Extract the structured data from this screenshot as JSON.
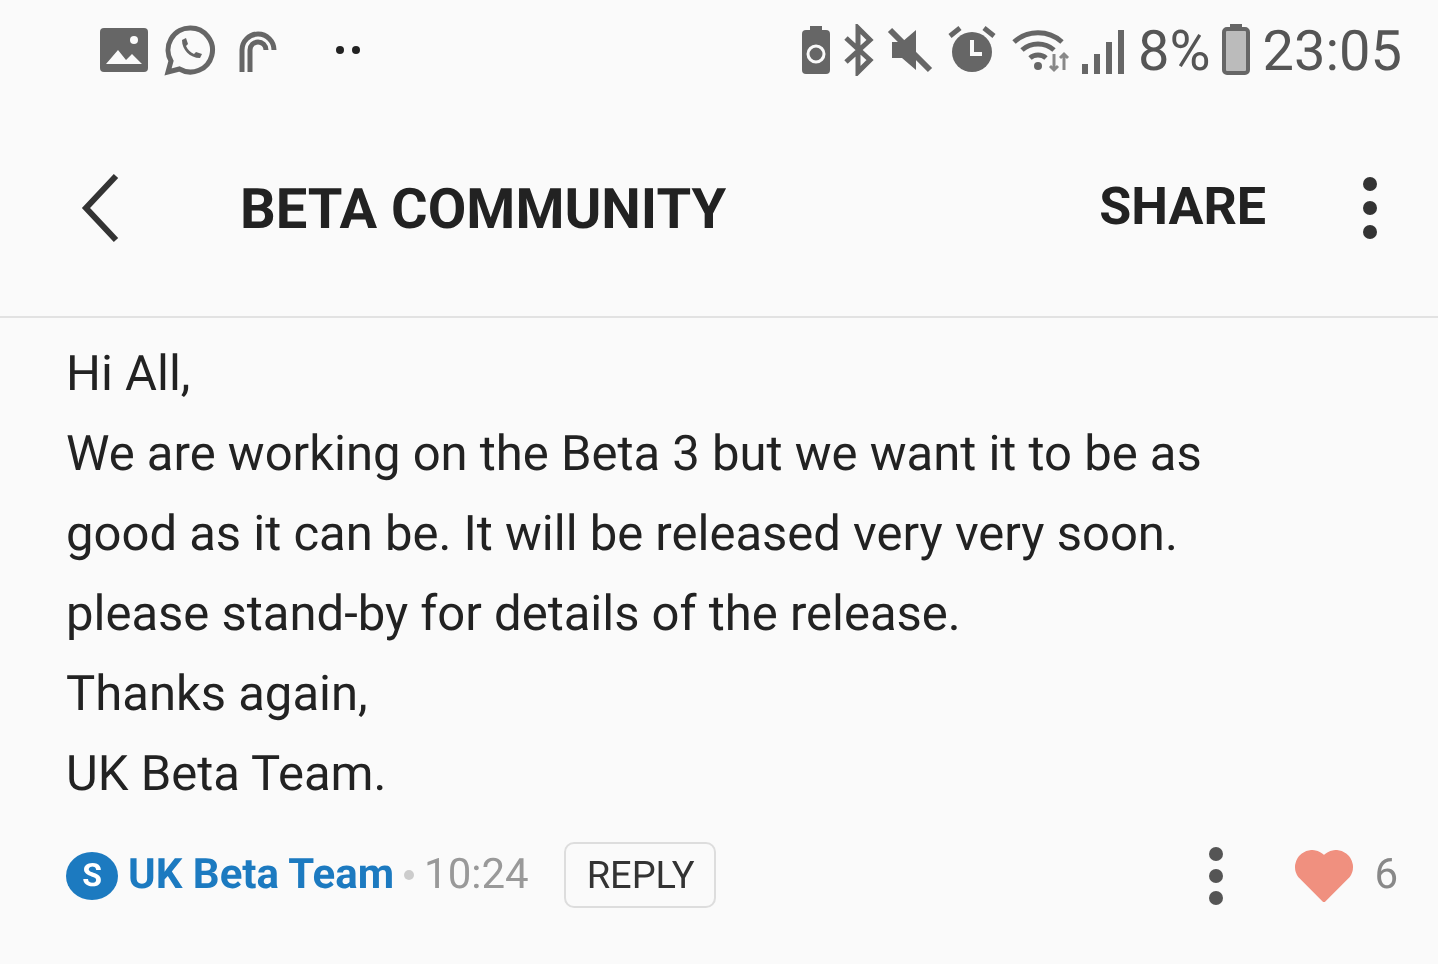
{
  "status_bar": {
    "battery_text": "8%",
    "time": "23:05"
  },
  "header": {
    "title": "BETA COMMUNITY",
    "share": "SHARE"
  },
  "post": {
    "lines": [
      "Hi All,",
      "We are working on the Beta 3 but we want it to be as",
      "good as it can be. It will be released very very soon.",
      "please stand-by for details of the release.",
      "Thanks again,",
      "UK Beta Team."
    ],
    "author_badge": "S",
    "author": "UK Beta Team",
    "time": "10:24",
    "reply": "REPLY",
    "liked": true,
    "likes": "6"
  }
}
